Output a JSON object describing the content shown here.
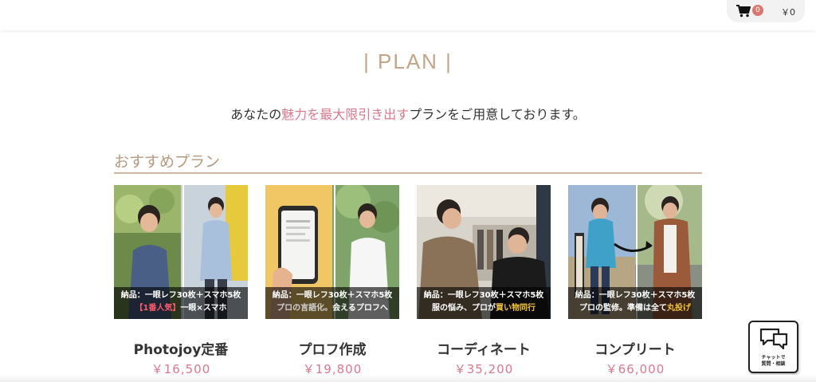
{
  "header": {
    "cart_count": "0",
    "cart_total": "￥0"
  },
  "page": {
    "title": "| PLAN |",
    "intro_before": "あなたの",
    "intro_highlight": "魅力を最大限引き出す",
    "intro_after": "プランをご用意しております。"
  },
  "section": {
    "heading": "おすすめプラン"
  },
  "plans": [
    {
      "name": "Photojoy定番",
      "price": "￥16,500",
      "caption_line1": "納品：一眼レフ30枚＋スマホ5枚",
      "caption_line2_accent": "【1番人気】",
      "caption_line2_rest": "一眼×スマホ"
    },
    {
      "name": "プロフ作成",
      "price": "￥19,800",
      "caption_line1": "納品：一眼レフ30枚＋スマホ5枚",
      "caption_line2_accent": "プロの言語化。",
      "caption_line2_rest": "会えるプロフへ"
    },
    {
      "name": "コーディネート",
      "price": "￥35,200",
      "caption_line1": "納品：一眼レフ30枚＋スマホ5枚",
      "caption_line2_rest": "服の悩み、プロが",
      "caption_line2_accent": "買い物同行"
    },
    {
      "name": "コンプリート",
      "price": "￥66,000",
      "caption_line1": "納品：一眼レフ30枚＋スマホ5枚",
      "caption_line2_rest": "プロの監修。準備は全て",
      "caption_line2_accent": "丸投げ"
    }
  ],
  "chat": {
    "line1": "チャットで",
    "line2": "質問・相談"
  },
  "colors": {
    "accent_pink": "#d77a8e",
    "title_beige": "#c2a588",
    "badge": "#d9786e"
  },
  "icons": [
    "cart-icon",
    "chat-bubbles-icon",
    "arrow-icon"
  ]
}
